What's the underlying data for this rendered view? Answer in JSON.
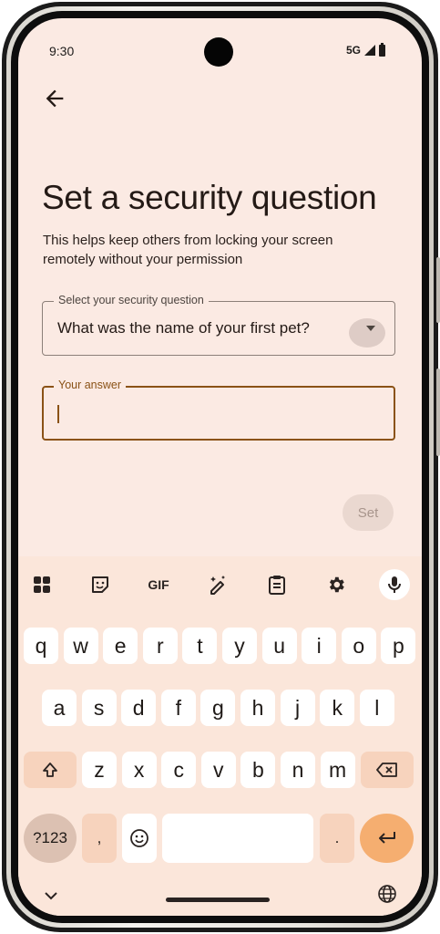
{
  "status": {
    "time": "9:30",
    "network": "5G"
  },
  "header": {
    "title": "Set a security question",
    "description": "This helps keep others from locking your screen remotely without your permission"
  },
  "question_field": {
    "label": "Select your security question",
    "value": "What was the name of your first pet?"
  },
  "answer_field": {
    "label": "Your answer",
    "value": ""
  },
  "actions": {
    "set_label": "Set"
  },
  "keyboard": {
    "toolbar": [
      "apps-icon",
      "sticker-icon",
      "gif-label",
      "magic-pen-icon",
      "clipboard-icon",
      "gear-icon",
      "mic-icon"
    ],
    "gif_label": "GIF",
    "row1": [
      "q",
      "w",
      "e",
      "r",
      "t",
      "y",
      "u",
      "i",
      "o",
      "p"
    ],
    "row2": [
      "a",
      "s",
      "d",
      "f",
      "g",
      "h",
      "j",
      "k",
      "l"
    ],
    "row3": [
      "z",
      "x",
      "c",
      "v",
      "b",
      "n",
      "m"
    ],
    "symbols_label": "?123",
    "comma": ",",
    "period": "."
  },
  "colors": {
    "background": "#fbeae3",
    "accent": "#8a5216",
    "keyboard_bg": "#fbe6da",
    "enter": "#f5ae70"
  }
}
